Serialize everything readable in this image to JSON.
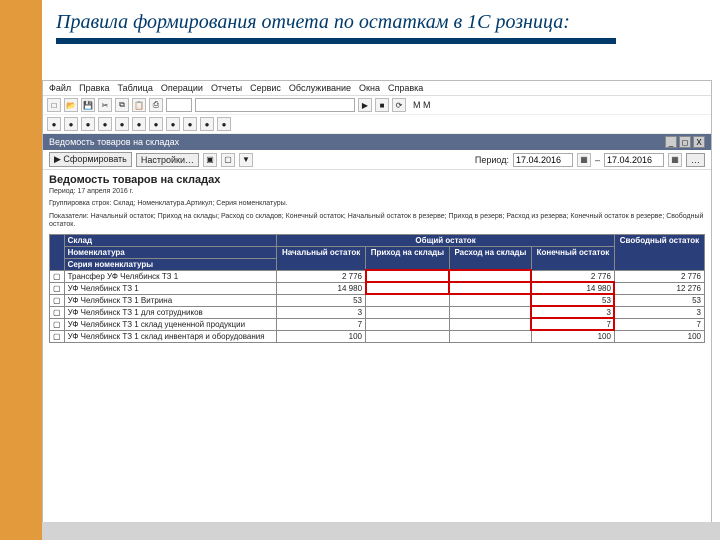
{
  "title": "Правила формирования отчета по остаткам в 1С розница:",
  "menu": {
    "items": [
      "Файл",
      "Правка",
      "Таблица",
      "Операции",
      "Отчеты",
      "Сервис",
      "Обслуживание",
      "Окна",
      "Справка"
    ]
  },
  "toolbar2_label": "M  M",
  "tab_title": "Ведомость товаров на складах",
  "window_ctrls": {
    "min": "_",
    "max": "◻",
    "close": "X"
  },
  "controls": {
    "form_btn": "▶ Сформировать",
    "settings_btn": "Настройки…",
    "period_label": "Период:",
    "date_from": "17.04.2016",
    "date_to": "17.04.2016",
    "dots": "…"
  },
  "report": {
    "title": "Ведомость товаров на складах",
    "period_line": "Период: 17 апреля 2016 г.",
    "group_line": "Группировка строк: Склад; Номенклатура.Артикул; Серия номенклатуры.",
    "ind_line": "Показатели: Начальный остаток; Приход на склады; Расход со складов; Конечный остаток; Начальный остаток в резерве; Приход в резерв; Расход из резерва; Конечный остаток в резерве; Свободный остаток.",
    "head": {
      "warehouse": "Склад",
      "nomen": "Номенклатура",
      "series": "Серия номенклатуры",
      "common": "Общий остаток",
      "start": "Начальный остаток",
      "in": "Приход на склады",
      "out": "Расход на склады",
      "end": "Конечный остаток",
      "free": "Свободный остаток"
    },
    "rows": [
      {
        "label": "Трансфер УФ Челябинск ТЗ 1",
        "start": "2 776",
        "in": "",
        "out": "",
        "end": "2 776",
        "free": "2 776",
        "red_in": true,
        "red_out": true,
        "red_end": false
      },
      {
        "label": "УФ Челябинск ТЗ 1",
        "start": "14 980",
        "in": "",
        "out": "",
        "end": "14 980",
        "free": "12 276",
        "red_in": true,
        "red_out": true,
        "red_end": true
      },
      {
        "label": "УФ Челябинск ТЗ 1 Витрина",
        "start": "53",
        "in": "",
        "out": "",
        "end": "53",
        "free": "53",
        "red_in": false,
        "red_out": false,
        "red_end": true
      },
      {
        "label": "УФ Челябинск ТЗ 1 для сотрудников",
        "start": "3",
        "in": "",
        "out": "",
        "end": "3",
        "free": "3",
        "red_in": false,
        "red_out": false,
        "red_end": true
      },
      {
        "label": "УФ Челябинск ТЗ 1 склад уцененной продукции",
        "start": "7",
        "in": "",
        "out": "",
        "end": "7",
        "free": "7",
        "red_in": false,
        "red_out": false,
        "red_end": true
      },
      {
        "label": "УФ Челябинск ТЗ 1 склад инвентаря и оборудования",
        "start": "100",
        "in": "",
        "out": "",
        "end": "100",
        "free": "100",
        "red_in": false,
        "red_out": false,
        "red_end": false
      }
    ]
  }
}
